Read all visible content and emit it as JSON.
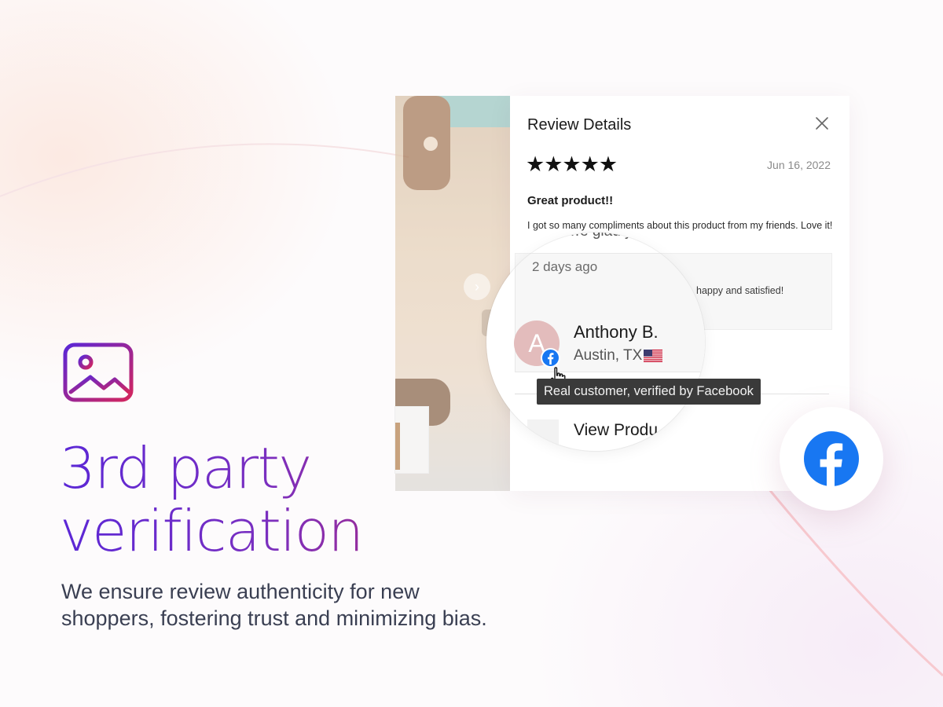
{
  "hero": {
    "headline_line1": "3rd party",
    "headline_line2": "verification",
    "subtext": "We ensure review authenticity for new shoppers, fostering trust and minimizing bias.",
    "icon": "image-icon"
  },
  "review_panel": {
    "title": "Review Details",
    "close_icon": "close-icon",
    "rating": 5,
    "stars": "★★★★★",
    "date": "Jun 16, 2022",
    "review_title": "Great product!!",
    "review_body": "I got so many compliments about this product from my friends. Love it!",
    "reply_partial": "happy and satisfied!"
  },
  "magnifier": {
    "partial_text": "…e glad yo",
    "relative_time": "2 days ago",
    "avatar_initial": "A",
    "reviewer_name": "Anthony B.",
    "reviewer_location": "Austin, TX",
    "flag_icon": "us-flag-icon",
    "badge_icon": "facebook-badge-icon",
    "view_product": "View Produ"
  },
  "tooltip": "Real customer, verified by Facebook",
  "product_nav_icon": "chevron-right-icon",
  "colors": {
    "gradient_start": "#5b27d6",
    "gradient_end": "#b02a7a",
    "facebook_blue": "#1877f2",
    "avatar_bg": "#e3bcbc",
    "tooltip_bg": "#3a3a3a"
  }
}
